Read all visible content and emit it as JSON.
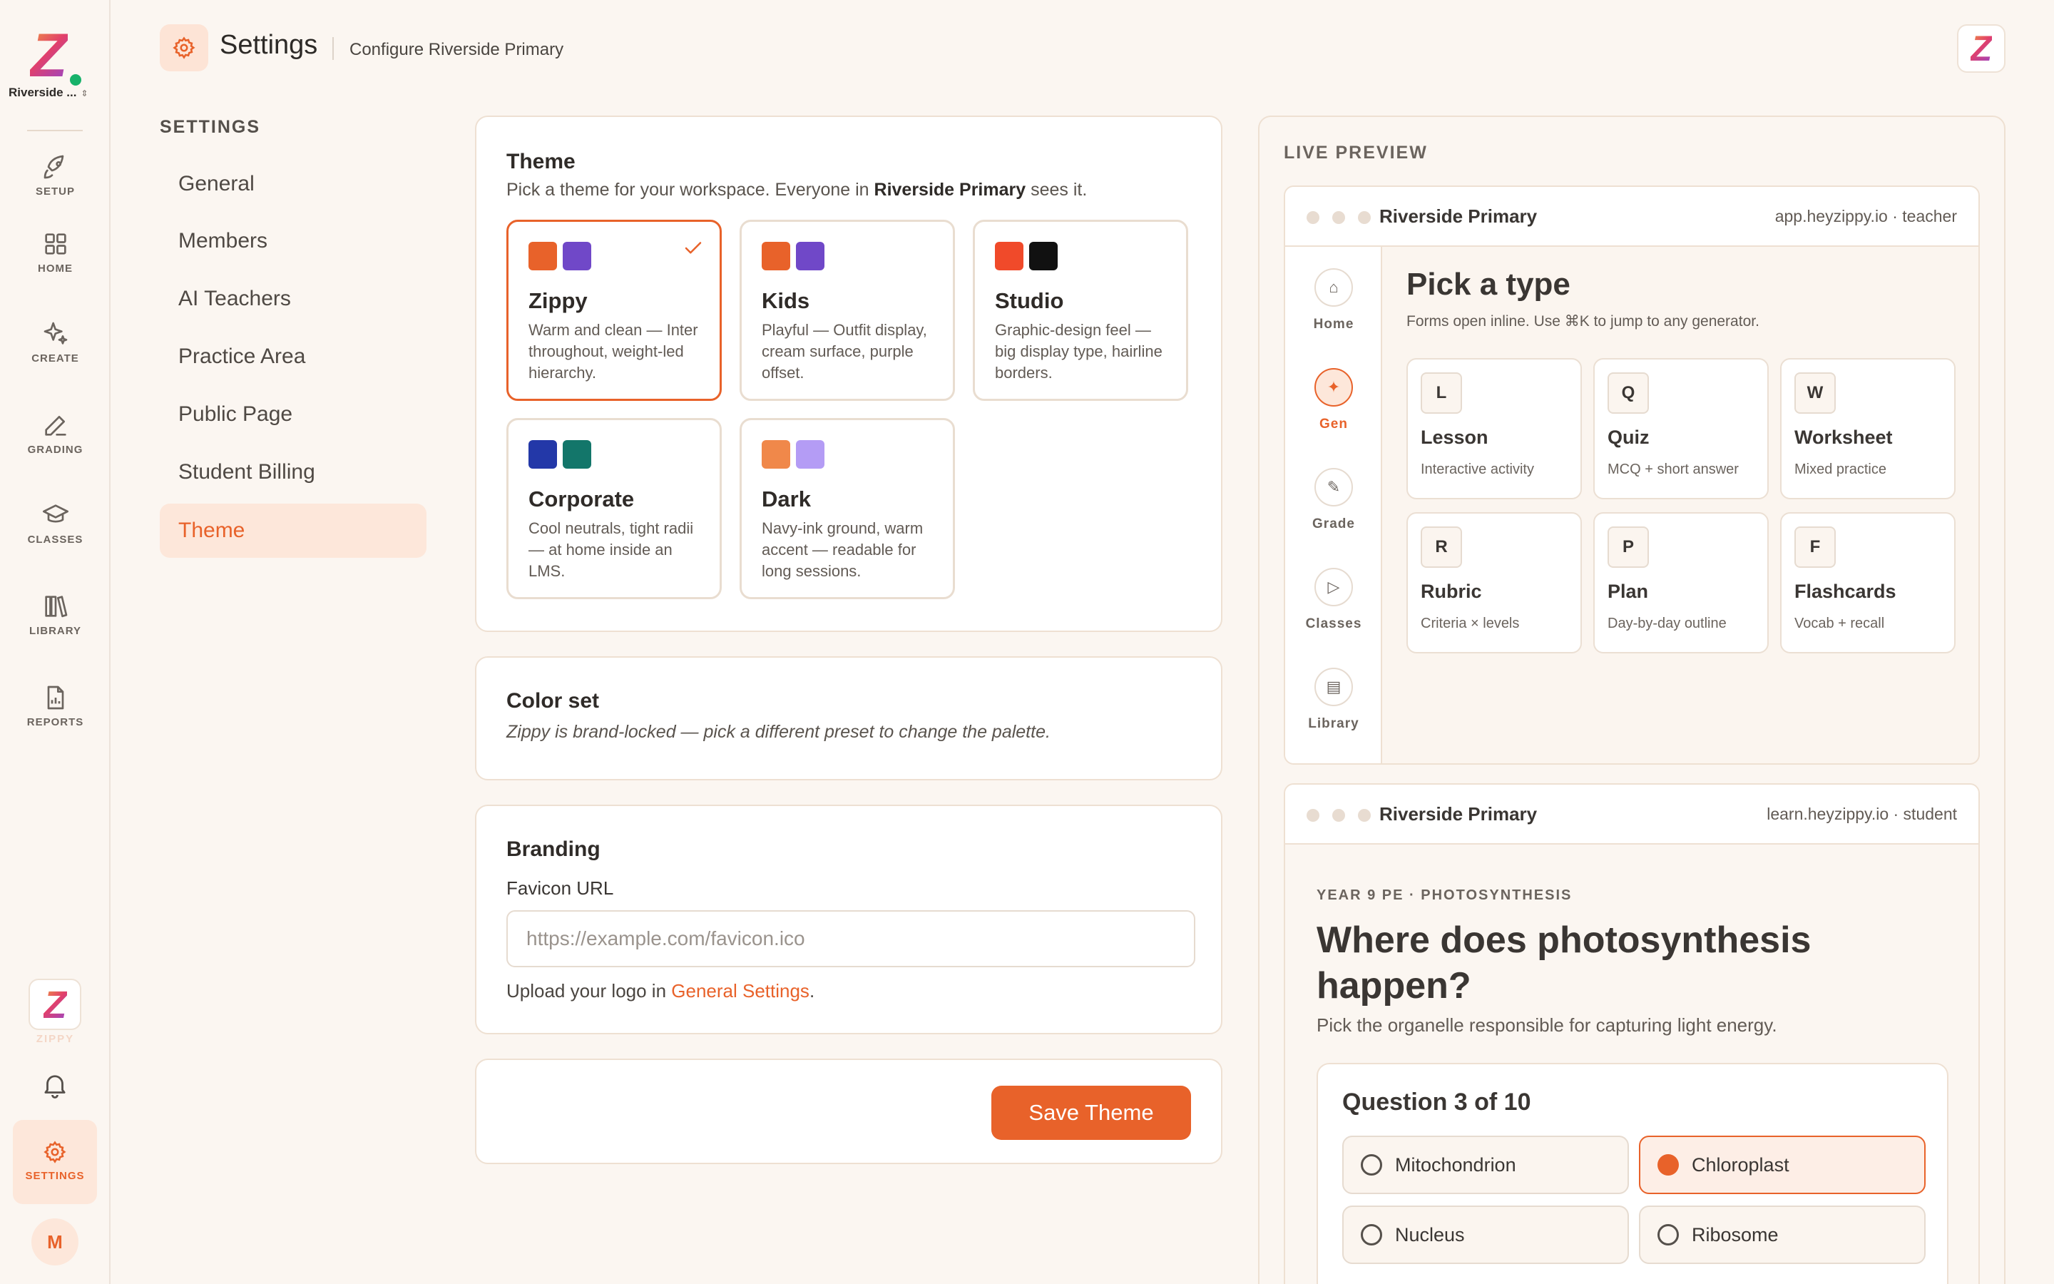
{
  "workspace": {
    "short_name": "Riverside ...",
    "chevron": "⌃⌄"
  },
  "rail": {
    "items": [
      {
        "label": "SETUP",
        "icon": "rocket-icon"
      },
      {
        "label": "HOME",
        "icon": "grid-icon"
      },
      {
        "label": "CREATE",
        "icon": "sparkle-icon"
      },
      {
        "label": "GRADING",
        "icon": "pen-icon"
      },
      {
        "label": "CLASSES",
        "icon": "graduation-cap-icon"
      },
      {
        "label": "LIBRARY",
        "icon": "books-icon"
      },
      {
        "label": "REPORTS",
        "icon": "report-icon"
      }
    ],
    "zippy_label": "ZIPPY",
    "settings_label": "SETTINGS",
    "avatar_initial": "M"
  },
  "header": {
    "title": "Settings",
    "subtitle": "Configure Riverside Primary"
  },
  "settings_nav": {
    "heading": "SETTINGS",
    "items": [
      "General",
      "Members",
      "AI Teachers",
      "Practice Area",
      "Public Page",
      "Student Billing",
      "Theme"
    ],
    "active": "Theme"
  },
  "theme": {
    "title": "Theme",
    "desc_pre": "Pick a theme for your workspace. Everyone in ",
    "desc_bold": "Riverside Primary",
    "desc_post": " sees it.",
    "options": [
      {
        "name": "Zippy",
        "desc": "Warm and clean — Inter throughout, weight-led hierarchy.",
        "colors": [
          "#e8622a",
          "#7048c8"
        ],
        "selected": true
      },
      {
        "name": "Kids",
        "desc": "Playful — Outfit display, cream surface, purple offset.",
        "colors": [
          "#e8622a",
          "#7048c8"
        ]
      },
      {
        "name": "Studio",
        "desc": "Graphic-design feel — big display type, hairline borders.",
        "colors": [
          "#f04a2a",
          "#111111"
        ]
      },
      {
        "name": "Corporate",
        "desc": "Cool neutrals, tight radii — at home inside an LMS.",
        "colors": [
          "#2338a8",
          "#13766a"
        ]
      },
      {
        "name": "Dark",
        "desc": "Navy-ink ground, warm accent — readable for long sessions.",
        "colors": [
          "#f0884a",
          "#b49cf5"
        ]
      }
    ]
  },
  "color_set": {
    "title": "Color set",
    "note": "Zippy is brand-locked — pick a different preset to change the palette."
  },
  "branding": {
    "title": "Branding",
    "favicon_label": "Favicon URL",
    "favicon_placeholder": "https://example.com/favicon.ico",
    "upload_pre": "Upload your logo in ",
    "upload_link": "General Settings",
    "upload_post": "."
  },
  "save": {
    "label": "Save Theme"
  },
  "live_preview": {
    "heading": "LIVE PREVIEW",
    "teacher": {
      "title": "Riverside Primary",
      "url": "app.heyzippy.io · teacher",
      "rail": [
        {
          "label": "Home",
          "glyph": "⌂"
        },
        {
          "label": "Gen",
          "glyph": "✦",
          "active": true
        },
        {
          "label": "Grade",
          "glyph": "✎"
        },
        {
          "label": "Classes",
          "glyph": "▷"
        },
        {
          "label": "Library",
          "glyph": "▤"
        }
      ],
      "heading": "Pick a type",
      "sub": "Forms open inline. Use ⌘K to jump to any generator.",
      "types": [
        {
          "key": "L",
          "name": "Lesson",
          "desc": "Interactive activity"
        },
        {
          "key": "Q",
          "name": "Quiz",
          "desc": "MCQ + short answer"
        },
        {
          "key": "W",
          "name": "Worksheet",
          "desc": "Mixed practice"
        },
        {
          "key": "R",
          "name": "Rubric",
          "desc": "Criteria × levels"
        },
        {
          "key": "P",
          "name": "Plan",
          "desc": "Day-by-day outline"
        },
        {
          "key": "F",
          "name": "Flashcards",
          "desc": "Vocab + recall"
        }
      ]
    },
    "student": {
      "title": "Riverside Primary",
      "url": "learn.heyzippy.io · student",
      "caption": "YEAR 9 PE · PHOTOSYNTHESIS",
      "question": "Where does photosynthesis happen?",
      "sub": "Pick the organelle responsible for capturing light energy.",
      "progress": "Question 3 of 10",
      "options": [
        {
          "label": "Mitochondrion"
        },
        {
          "label": "Chloroplast",
          "selected": true
        },
        {
          "label": "Nucleus"
        },
        {
          "label": "Ribosome"
        }
      ]
    }
  },
  "colors": {
    "accent": "#e8622a",
    "accent_soft": "#fde7da",
    "background": "#fbf6f1",
    "success": "#17b26a"
  }
}
